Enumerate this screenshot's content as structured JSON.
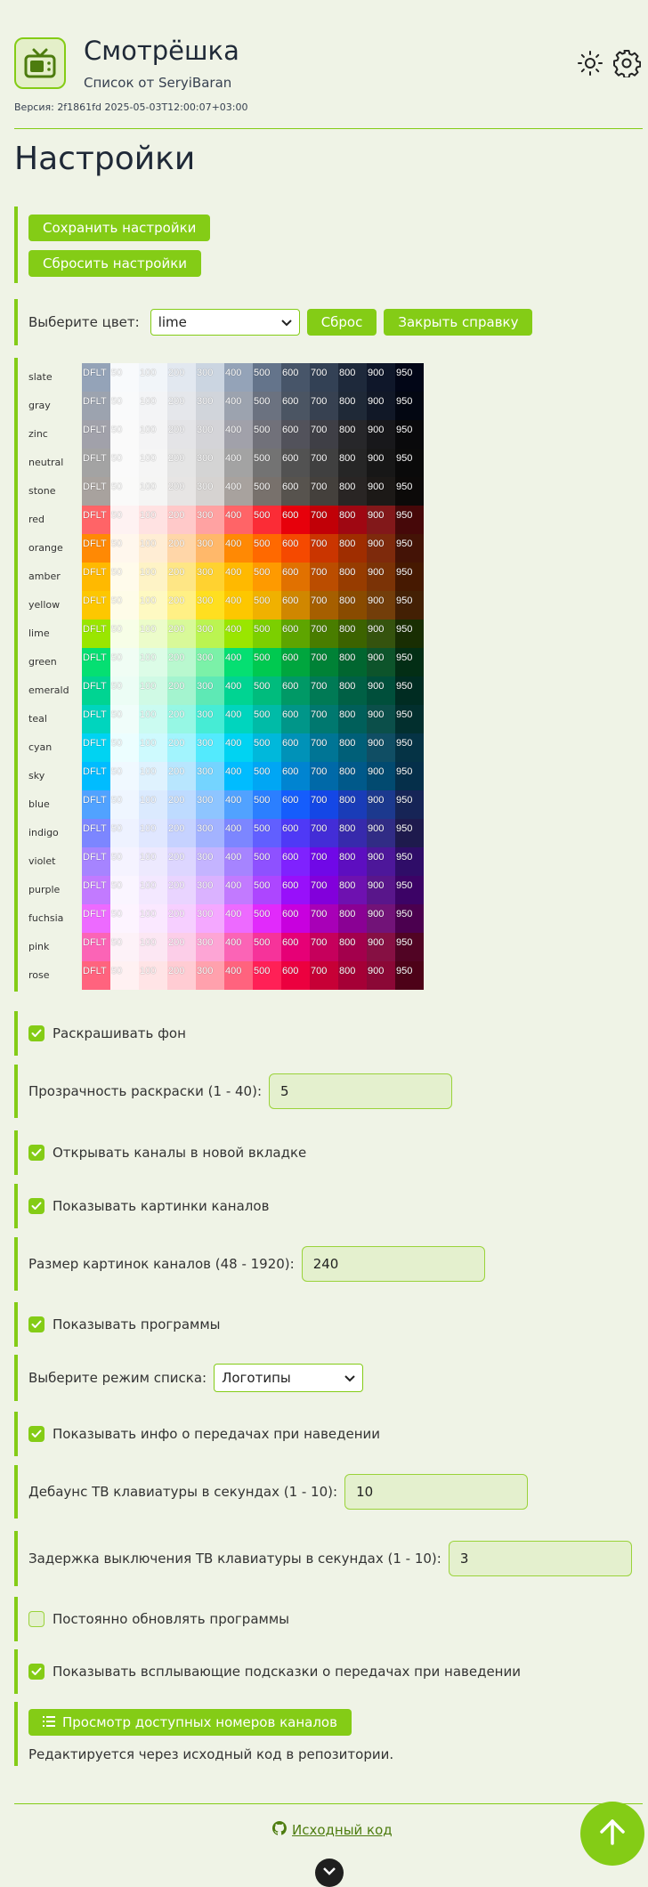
{
  "header": {
    "title": "Смотрёшка",
    "subtitle": "Список от SeryiBaran",
    "version": "Версия: 2f1861fd 2025-05-03T12:00:07+03:00",
    "logo_icon": "tv-icon",
    "theme_icon": "sun-icon",
    "settings_icon": "gear-icon"
  },
  "page_title": "Настройки",
  "actions": {
    "save": "Сохранить настройки",
    "reset": "Сбросить настройки"
  },
  "color_picker": {
    "label": "Выберите цвет:",
    "selected": "lime",
    "reset": "Сброс",
    "close_help": "Закрыть справку"
  },
  "palette": {
    "shades": [
      "DFLT",
      "50",
      "100",
      "200",
      "300",
      "400",
      "500",
      "600",
      "700",
      "800",
      "900",
      "950"
    ],
    "colors": [
      {
        "name": "slate",
        "swatches": [
          "#94a3b8",
          "#f8fafc",
          "#f1f5f9",
          "#e2e8f0",
          "#cbd5e1",
          "#94a3b8",
          "#64748b",
          "#475569",
          "#334155",
          "#1e293b",
          "#0f172a",
          "#020617"
        ]
      },
      {
        "name": "gray",
        "swatches": [
          "#9ca3af",
          "#f9fafb",
          "#f3f4f6",
          "#e5e7eb",
          "#d1d5db",
          "#9ca3af",
          "#6b7280",
          "#4b5563",
          "#374151",
          "#1f2937",
          "#111827",
          "#030712"
        ]
      },
      {
        "name": "zinc",
        "swatches": [
          "#a1a1aa",
          "#fafafa",
          "#f4f4f5",
          "#e4e4e7",
          "#d4d4d8",
          "#a1a1aa",
          "#71717a",
          "#52525b",
          "#3f3f46",
          "#27272a",
          "#18181b",
          "#09090b"
        ]
      },
      {
        "name": "neutral",
        "swatches": [
          "#a3a3a3",
          "#fafafa",
          "#f5f5f5",
          "#e5e5e5",
          "#d4d4d4",
          "#a3a3a3",
          "#737373",
          "#525252",
          "#404040",
          "#262626",
          "#171717",
          "#0a0a0a"
        ]
      },
      {
        "name": "stone",
        "swatches": [
          "#a8a29e",
          "#fafaf9",
          "#f5f5f4",
          "#e7e5e4",
          "#d6d3d1",
          "#a8a29e",
          "#78716c",
          "#57534e",
          "#44403c",
          "#292524",
          "#1c1917",
          "#0c0a09"
        ]
      },
      {
        "name": "red",
        "swatches": [
          "#ff6467",
          "#fef2f2",
          "#ffe2e2",
          "#ffc9c9",
          "#ffa2a2",
          "#ff6467",
          "#fb2c36",
          "#e7000b",
          "#c10007",
          "#9f0712",
          "#82181a",
          "#460809"
        ]
      },
      {
        "name": "orange",
        "swatches": [
          "#ff8904",
          "#fff7ed",
          "#ffedd4",
          "#ffd6a8",
          "#ffb86a",
          "#ff8904",
          "#ff6900",
          "#f54900",
          "#ca3500",
          "#9f2d00",
          "#7e2a0c",
          "#441306"
        ]
      },
      {
        "name": "amber",
        "swatches": [
          "#ffb900",
          "#fffbeb",
          "#fef3c6",
          "#fee685",
          "#ffd230",
          "#ffb900",
          "#fe9a00",
          "#e17100",
          "#bb4d00",
          "#973c00",
          "#7b3306",
          "#461901"
        ]
      },
      {
        "name": "yellow",
        "swatches": [
          "#fdc700",
          "#fefce8",
          "#fef9c2",
          "#fff085",
          "#ffdf20",
          "#fdc700",
          "#f0b100",
          "#d08700",
          "#a65f00",
          "#894b00",
          "#733e0a",
          "#432004"
        ]
      },
      {
        "name": "lime",
        "swatches": [
          "#9ae600",
          "#f7fee7",
          "#ecfcca",
          "#d8f999",
          "#bbf451",
          "#9ae600",
          "#7ccf00",
          "#5ea500",
          "#497d00",
          "#3c6300",
          "#35530e",
          "#192e03"
        ]
      },
      {
        "name": "green",
        "swatches": [
          "#05df72",
          "#f0fdf4",
          "#dcfce7",
          "#b9f8cf",
          "#7bf1a8",
          "#05df72",
          "#00c950",
          "#00a63e",
          "#008236",
          "#016630",
          "#0d542b",
          "#032e15"
        ]
      },
      {
        "name": "emerald",
        "swatches": [
          "#00d492",
          "#ecfdf5",
          "#d0fae5",
          "#a4f4cf",
          "#5ee9b5",
          "#00d492",
          "#00bc7d",
          "#009966",
          "#007a55",
          "#006045",
          "#004f3b",
          "#002c22"
        ]
      },
      {
        "name": "teal",
        "swatches": [
          "#00d5be",
          "#f0fdfa",
          "#cbfbf1",
          "#96f7e4",
          "#46ecd5",
          "#00d5be",
          "#00bba7",
          "#009689",
          "#00786f",
          "#005f5a",
          "#0b4f4a",
          "#022f2e"
        ]
      },
      {
        "name": "cyan",
        "swatches": [
          "#00d3f2",
          "#ecfeff",
          "#cefafe",
          "#a2f4fd",
          "#53eafd",
          "#00d3f2",
          "#00b8db",
          "#0092b8",
          "#007595",
          "#005f78",
          "#104e64",
          "#053345"
        ]
      },
      {
        "name": "sky",
        "swatches": [
          "#00bcff",
          "#f0f9ff",
          "#dff2fe",
          "#b8e6fe",
          "#74d4ff",
          "#00bcff",
          "#00a6f4",
          "#0084d1",
          "#0069a8",
          "#00598a",
          "#024a70",
          "#052f4a"
        ]
      },
      {
        "name": "blue",
        "swatches": [
          "#51a2ff",
          "#eff6ff",
          "#dbeafe",
          "#bedbff",
          "#8ec5ff",
          "#51a2ff",
          "#2b7fff",
          "#155dfc",
          "#1447e6",
          "#193cb8",
          "#1c398e",
          "#162456"
        ]
      },
      {
        "name": "indigo",
        "swatches": [
          "#7c86ff",
          "#eef2ff",
          "#e0e7ff",
          "#c6d2ff",
          "#a3b3ff",
          "#7c86ff",
          "#615fff",
          "#4f39f6",
          "#432dd7",
          "#372aac",
          "#312c85",
          "#1e1a4d"
        ]
      },
      {
        "name": "violet",
        "swatches": [
          "#a684ff",
          "#f5f3ff",
          "#ede9fe",
          "#ddd6ff",
          "#c4b4ff",
          "#a684ff",
          "#8e51ff",
          "#7f22fe",
          "#7008e7",
          "#5d0ec0",
          "#4d179a",
          "#2f0d68"
        ]
      },
      {
        "name": "purple",
        "swatches": [
          "#c27aff",
          "#faf5ff",
          "#f3e8ff",
          "#e9d4ff",
          "#dab2ff",
          "#c27aff",
          "#ad46ff",
          "#9810fa",
          "#8200db",
          "#6e11b0",
          "#59168b",
          "#3c0366"
        ]
      },
      {
        "name": "fuchsia",
        "swatches": [
          "#ed6aff",
          "#fdf4ff",
          "#fae8ff",
          "#f6cfff",
          "#f4a8ff",
          "#ed6aff",
          "#e12afb",
          "#c800de",
          "#a800b7",
          "#8a0194",
          "#721378",
          "#4b004f"
        ]
      },
      {
        "name": "pink",
        "swatches": [
          "#fb64b6",
          "#fdf2f8",
          "#fce7f3",
          "#fccee8",
          "#fda5d5",
          "#fb64b6",
          "#f6339a",
          "#e60076",
          "#c6005c",
          "#a3004c",
          "#861043",
          "#510424"
        ]
      },
      {
        "name": "rose",
        "swatches": [
          "#ff637e",
          "#fff1f2",
          "#ffe4e6",
          "#ffccd3",
          "#ffa1ad",
          "#ff637e",
          "#ff2056",
          "#ec003f",
          "#c70036",
          "#a50036",
          "#8b0836",
          "#4d0218"
        ]
      }
    ]
  },
  "settings": {
    "colorize_bg": "Раскрашивать фон",
    "opacity_label": "Прозрачность раскраски (1 - 40):",
    "opacity_value": "5",
    "new_tab": "Открывать каналы в новой вкладке",
    "show_images": "Показывать картинки каналов",
    "image_size_label": "Размер картинок каналов (48 - 1920):",
    "image_size_value": "240",
    "show_programs": "Показывать программы",
    "list_mode_label": "Выберите режим списка:",
    "list_mode_value": "Логотипы",
    "hover_info": "Показывать инфо о передачах при наведении",
    "debounce_label": "Дебаунс ТВ клавиатуры в секундах (1 - 10):",
    "debounce_value": "10",
    "off_delay_label": "Задержка выключения ТВ клавиатуры в секундах (1 - 10):",
    "off_delay_value": "3",
    "auto_update": "Постоянно обновлять программы",
    "tooltips": "Показывать всплывающие подсказки о передачах при наведении",
    "view_numbers": "Просмотр доступных номеров каналов",
    "edit_note": "Редактируется через исходный код в репозитории."
  },
  "checkbox_states": {
    "colorize_bg": true,
    "new_tab": true,
    "show_images": true,
    "show_programs": true,
    "hover_info": true,
    "auto_update": false,
    "tooltips": true
  },
  "footer": {
    "source_link": "Исходный код"
  },
  "colors": {
    "accent": "#84cc16",
    "background": "#eff3e6",
    "input_bg": "#e4f0ce"
  }
}
